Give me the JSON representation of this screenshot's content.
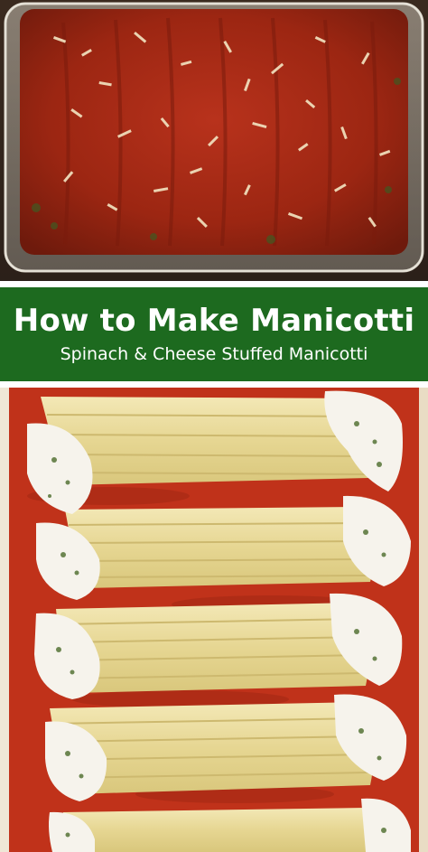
{
  "banner": {
    "title": "How to Make Manicotti",
    "subtitle": "Spinach & Cheese Stuffed Manicotti",
    "background_color": "#1d6a1f",
    "text_color": "#ffffff"
  },
  "photos": {
    "top": {
      "subject": "baked manicotti in glass baking dish with tomato sauce and grated parmesan"
    },
    "bottom": {
      "subject": "unbaked manicotti shells stuffed with spinach ricotta filling on tomato sauce"
    }
  }
}
